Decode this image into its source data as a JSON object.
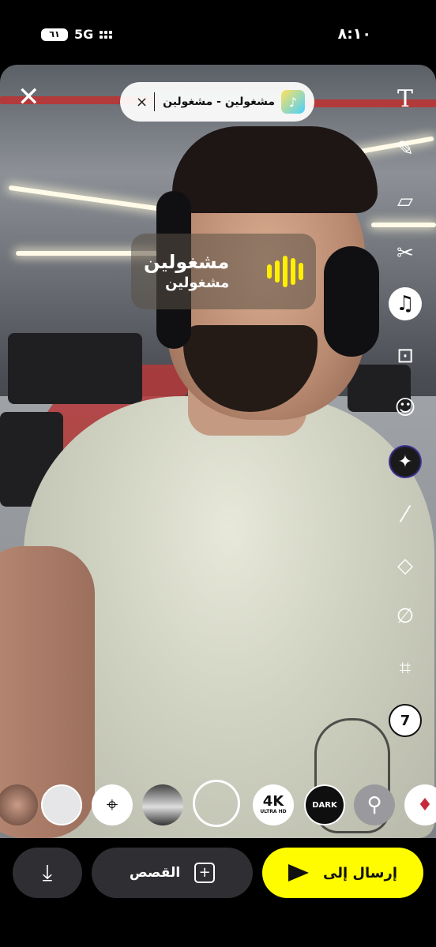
{
  "status_bar": {
    "time": "٨:١٠",
    "network": "5G",
    "battery": "٦١"
  },
  "music_pill": {
    "title": "مشغولين - مشغولين",
    "close_symbol": "×"
  },
  "close_button": {
    "symbol": "✕"
  },
  "toolbar": {
    "text": "T",
    "pen": "✎",
    "sticker": "▱",
    "scissors": "✂",
    "music": "♫",
    "story": "⊡",
    "emoji": "☺",
    "ai": "✦",
    "magic_wand": "⁄",
    "eraser": "◇",
    "attach": "∅",
    "crop": "⌗",
    "timer": "7"
  },
  "music_sticker": {
    "title": "مشغولين",
    "artist": "مشغولين"
  },
  "lenses": {
    "k4_main": "4K",
    "k4_sub": "ULTRA HD",
    "dark": "DARK"
  },
  "bottom": {
    "download_symbol": "⤓",
    "stories_label": "القصص",
    "stories_symbol": "+",
    "send_label": "إرسال إلى"
  },
  "colors": {
    "send_yellow": "#fffc00",
    "button_gray": "#2f2f33",
    "sticker_wave": "#fff000"
  }
}
